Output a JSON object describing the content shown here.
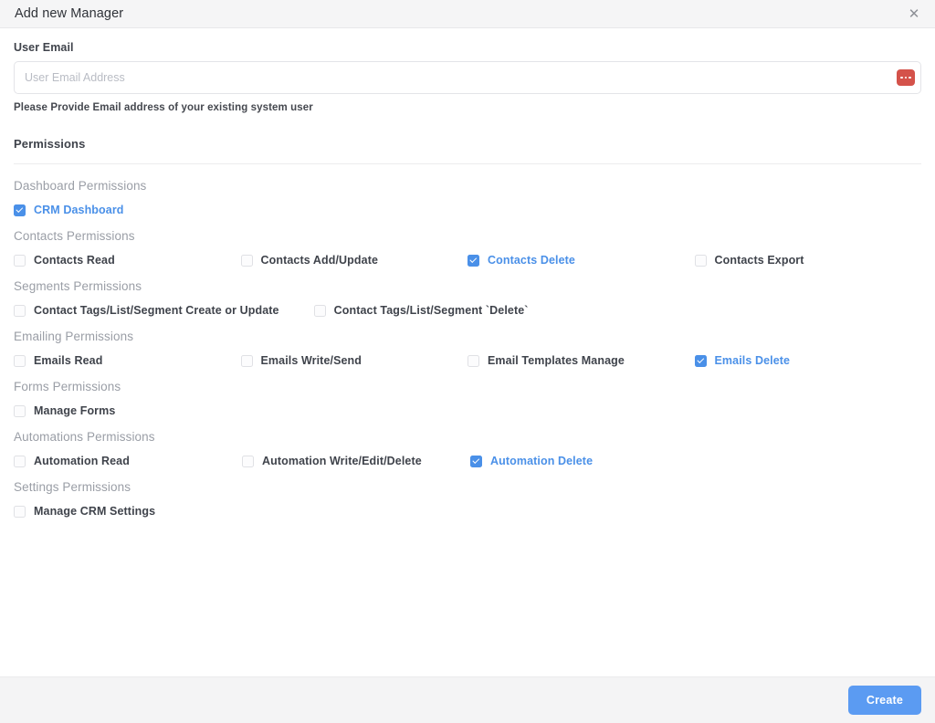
{
  "modal": {
    "title": "Add new Manager",
    "close_icon": "close-icon"
  },
  "form": {
    "email_label": "User Email",
    "email_value": "",
    "email_placeholder": "User Email Address",
    "email_action_icon": "ellipsis-icon",
    "help_text": "Please Provide Email address of your existing system user"
  },
  "permissions": {
    "title": "Permissions",
    "groups": [
      {
        "heading": "Dashboard Permissions",
        "layout": "fixed",
        "items": [
          {
            "label": "CRM Dashboard",
            "checked": true
          }
        ]
      },
      {
        "heading": "Contacts Permissions",
        "layout": "fixed",
        "items": [
          {
            "label": "Contacts Read",
            "checked": false
          },
          {
            "label": "Contacts Add/Update",
            "checked": false
          },
          {
            "label": "Contacts Delete",
            "checked": true
          },
          {
            "label": "Contacts Export",
            "checked": false
          }
        ]
      },
      {
        "heading": "Segments Permissions",
        "layout": "auto",
        "items": [
          {
            "label": "Contact Tags/List/Segment Create or Update",
            "checked": false
          },
          {
            "label": "Contact Tags/List/Segment `Delete`",
            "checked": false
          }
        ]
      },
      {
        "heading": "Emailing Permissions",
        "layout": "fixed",
        "items": [
          {
            "label": "Emails Read",
            "checked": false
          },
          {
            "label": "Emails Write/Send",
            "checked": false
          },
          {
            "label": "Email Templates Manage",
            "checked": false
          },
          {
            "label": "Emails Delete",
            "checked": true
          }
        ]
      },
      {
        "heading": "Forms Permissions",
        "layout": "fixed",
        "items": [
          {
            "label": "Manage Forms",
            "checked": false
          }
        ]
      },
      {
        "heading": "Automations Permissions",
        "layout": "fixed",
        "items": [
          {
            "label": "Automation Read",
            "checked": false
          },
          {
            "label": "Automation Write/Edit/Delete",
            "checked": false
          },
          {
            "label": "Automation Delete",
            "checked": true
          }
        ]
      },
      {
        "heading": "Settings Permissions",
        "layout": "fixed",
        "items": [
          {
            "label": "Manage CRM Settings",
            "checked": false
          }
        ]
      }
    ]
  },
  "footer": {
    "create_label": "Create"
  },
  "colors": {
    "accent": "#4a90e8",
    "primary_button": "#5b9bf2",
    "danger": "#d4524a",
    "header_bg": "#f5f5f6",
    "footer_bg": "#f4f4f5"
  }
}
